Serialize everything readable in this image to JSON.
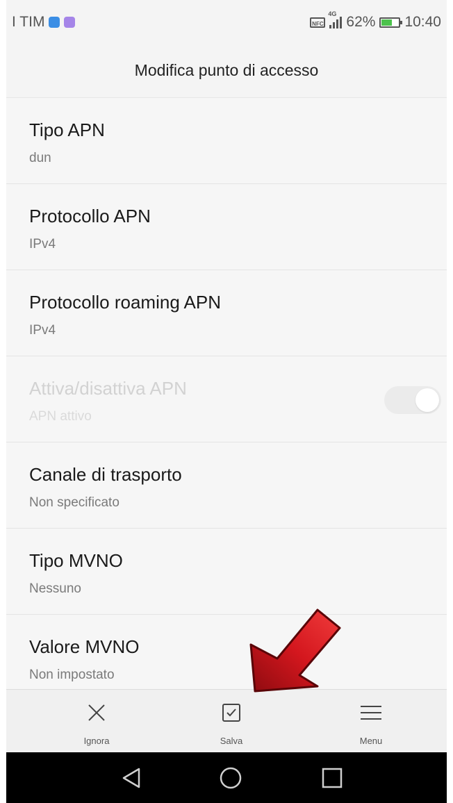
{
  "status_bar": {
    "carrier": "I TIM",
    "nfc_label": "NFC",
    "network_type": "4G",
    "battery_percent": "62%",
    "battery_level": 0.62,
    "time": "10:40",
    "icons": [
      "app-notification-blue-icon",
      "app-notification-purple-icon",
      "nfc-icon",
      "signal-icon",
      "battery-icon"
    ],
    "colors": {
      "blue_app": "#3b8ee5",
      "purple_app": "#a585e8",
      "battery_green": "#4cc24c"
    }
  },
  "header": {
    "title": "Modifica punto di accesso"
  },
  "settings": [
    {
      "title": "Tipo APN",
      "value": "dun"
    },
    {
      "title": "Protocollo APN",
      "value": "IPv4"
    },
    {
      "title": "Protocollo roaming APN",
      "value": "IPv4"
    },
    {
      "title": "Attiva/disattiva APN",
      "value": "APN attivo",
      "disabled": true,
      "toggle_on": true
    },
    {
      "title": "Canale di trasporto",
      "value": "Non specificato"
    },
    {
      "title": "Tipo MVNO",
      "value": "Nessuno"
    },
    {
      "title": "Valore MVNO",
      "value": "Non impostato"
    }
  ],
  "action_bar": {
    "ignore": {
      "label": "Ignora",
      "icon": "close-icon"
    },
    "save": {
      "label": "Salva",
      "icon": "checkbox-icon"
    },
    "menu": {
      "label": "Menu",
      "icon": "hamburger-menu-icon"
    }
  },
  "system_nav": {
    "icons": [
      "back-icon",
      "home-icon",
      "recents-icon"
    ]
  },
  "annotation": {
    "icon": "red-arrow-icon",
    "color": "#c8141a"
  }
}
